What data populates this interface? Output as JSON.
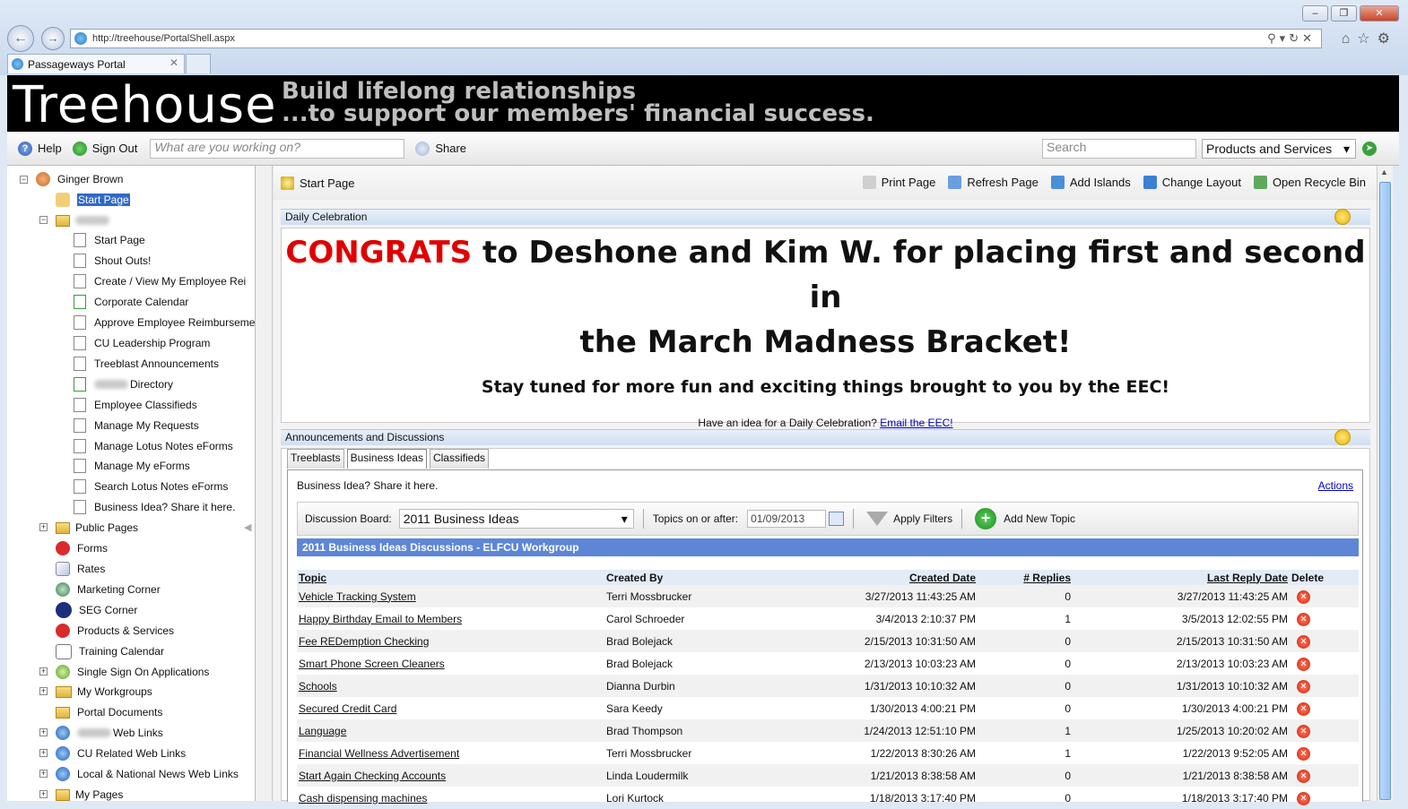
{
  "browser": {
    "url": "http://treehouse/PortalShell.aspx",
    "tab_title": "Passageways Portal",
    "window_buttons": [
      "–",
      "❐",
      "✕"
    ]
  },
  "banner": {
    "logo": "Treehouse",
    "tagline_line1": "Build lifelong relationships",
    "tagline_line2": "...to support our members' financial success."
  },
  "toolbar": {
    "help": "Help",
    "sign_out": "Sign Out",
    "what_placeholder": "What are you working on?",
    "share": "Share",
    "search_placeholder": "Search",
    "products_select": "Products and Services"
  },
  "sidebar": {
    "user": "Ginger Brown",
    "start_page": "Start Page",
    "workgroup_items": [
      "Start Page",
      "Shout Outs!",
      "Create / View My Employee Rei",
      "Corporate Calendar",
      "Approve Employee Reimburseme",
      "CU Leadership Program",
      "Treeblast Announcements",
      "Directory",
      "Employee Classifieds",
      "Manage My Requests",
      "Manage Lotus Notes eForms",
      "Manage My eForms",
      "Search Lotus Notes eForms",
      "Business Idea? Share it here."
    ],
    "public_pages": "Public Pages",
    "public_items": [
      "Forms",
      "Rates",
      "Marketing Corner",
      "SEG Corner",
      "Products & Services",
      "Training Calendar"
    ],
    "single_sign_on": "Single Sign On Applications",
    "my_workgroups": "My Workgroups",
    "portal_documents": "Portal Documents",
    "web_links": "Web Links",
    "cu_web_links": "CU Related Web Links",
    "news_links": "Local & National News Web Links",
    "my_pages": "My Pages"
  },
  "mainbar": {
    "start_page": "Start Page",
    "print": "Print Page",
    "refresh": "Refresh Page",
    "add_islands": "Add Islands",
    "change_layout": "Change Layout",
    "recycle": "Open Recycle Bin"
  },
  "celebration": {
    "header": "Daily Celebration",
    "congrats_word": "CONGRATS",
    "congrats_rest1": " to Deshone and Kim W. for placing first and second in",
    "congrats_rest2": "the March Madness Bracket!",
    "stay_tuned": "Stay tuned for more fun and exciting things brought to you by the EEC!",
    "idea_text": "Have an idea for a Daily Celebration? ",
    "idea_link": "Email the EEC!"
  },
  "announcements": {
    "header": "Announcements and Discussions",
    "tabs": [
      "Treeblasts",
      "Business Ideas",
      "Classifieds"
    ],
    "share_line": "Business Idea? Share it here.",
    "actions": "Actions",
    "board_label": "Discussion Board:",
    "board_value": "2011 Business Ideas",
    "topics_label": "Topics on or after:",
    "date_value": "01/09/2013",
    "apply": "Apply Filters",
    "add_topic": "Add New Topic",
    "discussion_title": "2011 Business Ideas Discussions - ELFCU Workgroup",
    "columns": [
      "Topic",
      "Created By",
      "Created Date",
      "# Replies",
      "Last Reply Date",
      "Delete"
    ],
    "rows": [
      [
        "Vehicle Tracking System",
        "Terri Mossbrucker",
        "3/27/2013 11:43:25 AM",
        "0",
        "3/27/2013 11:43:25 AM"
      ],
      [
        "Happy Birthday Email to Members",
        "Carol Schroeder",
        "3/4/2013 2:10:37 PM",
        "1",
        "3/5/2013 12:02:55 PM"
      ],
      [
        "Fee REDemption Checking",
        "Brad Bolejack",
        "2/15/2013 10:31:50 AM",
        "0",
        "2/15/2013 10:31:50 AM"
      ],
      [
        "Smart Phone Screen Cleaners",
        "Brad Bolejack",
        "2/13/2013 10:03:23 AM",
        "0",
        "2/13/2013 10:03:23 AM"
      ],
      [
        "Schools",
        "Dianna Durbin",
        "1/31/2013 10:10:32 AM",
        "0",
        "1/31/2013 10:10:32 AM"
      ],
      [
        "Secured Credit Card",
        "Sara Keedy",
        "1/30/2013 4:00:21 PM",
        "0",
        "1/30/2013 4:00:21 PM"
      ],
      [
        "Language",
        "Brad Thompson",
        "1/24/2013 12:51:10 PM",
        "1",
        "1/25/2013 10:20:02 AM"
      ],
      [
        "Financial Wellness Advertisement",
        "Terri Mossbrucker",
        "1/22/2013 8:30:26 AM",
        "1",
        "1/22/2013 9:52:05 AM"
      ],
      [
        "Start Again Checking Accounts",
        "Linda Loudermilk",
        "1/21/2013 8:38:58 AM",
        "0",
        "1/21/2013 8:38:58 AM"
      ],
      [
        "Cash dispensing machines",
        "Lori Kurtock",
        "1/18/2013 3:17:40 PM",
        "0",
        "1/18/2013 3:17:40 PM"
      ]
    ]
  }
}
